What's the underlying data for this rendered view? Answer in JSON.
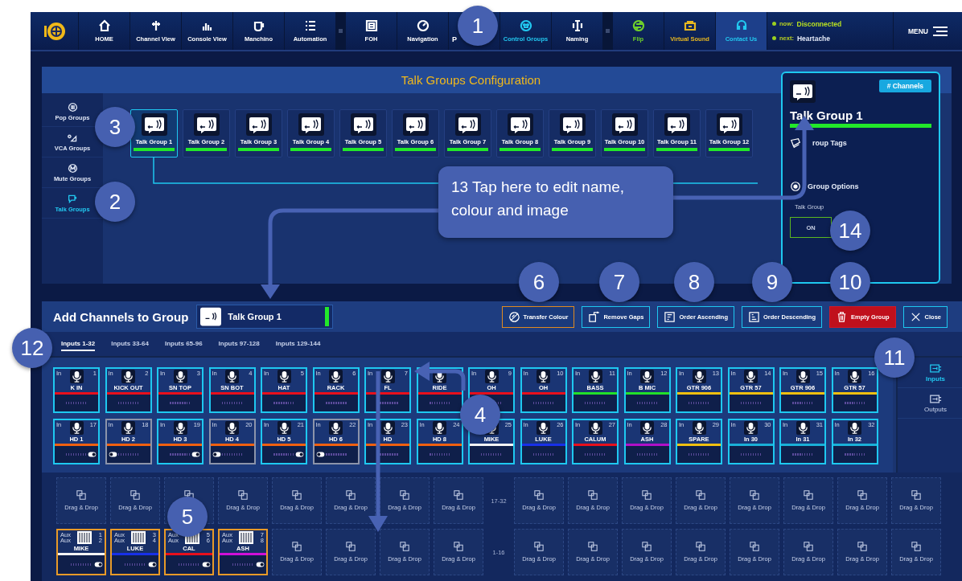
{
  "nav": {
    "items": [
      {
        "label": "HOME",
        "color": "#ffffff",
        "highlighted": false
      },
      {
        "label": "Channel View",
        "color": "#ffffff",
        "highlighted": false
      },
      {
        "label": "Console View",
        "color": "#ffffff",
        "highlighted": false
      },
      {
        "label": "Manchino",
        "color": "#ffffff",
        "highlighted": false
      },
      {
        "label": "Automation",
        "color": "#ffffff",
        "highlighted": false
      },
      {
        "label": "FOH",
        "color": "#ffffff",
        "highlighted": false
      },
      {
        "label": "Navigation",
        "color": "#ffffff",
        "highlighted": false
      },
      {
        "label": "P",
        "color": "#ffffff",
        "highlighted": false
      },
      {
        "label": "Control Groups",
        "color": "#22c8f0",
        "highlighted": false
      },
      {
        "label": "Naming",
        "color": "#ffffff",
        "highlighted": false
      },
      {
        "label": "Flip",
        "color": "#6fd12a",
        "highlighted": false
      },
      {
        "label": "Virtual Sound",
        "color": "#e8b820",
        "highlighted": false
      },
      {
        "label": "Contact Us",
        "color": "#22c8f0",
        "highlighted": true
      }
    ],
    "now_label": "now:",
    "now_value": "Disconnected",
    "next_label": "next:",
    "next_value": "Heartache",
    "menu": "MENU"
  },
  "config": {
    "title": "Talk Groups Configuration",
    "sidebar": [
      {
        "label": "Pop Groups",
        "selected": false
      },
      {
        "label": "VCA Groups",
        "selected": false
      },
      {
        "label": "Mute Groups",
        "selected": false
      },
      {
        "label": "Talk Groups",
        "selected": true
      }
    ],
    "groups": [
      {
        "label": "Talk Group 1",
        "selected": true
      },
      {
        "label": "Talk Group 2",
        "selected": false
      },
      {
        "label": "Talk Group 3",
        "selected": false
      },
      {
        "label": "Talk Group 4",
        "selected": false
      },
      {
        "label": "Talk Group 5",
        "selected": false
      },
      {
        "label": "Talk Group 6",
        "selected": false
      },
      {
        "label": "Talk Group 7",
        "selected": false
      },
      {
        "label": "Talk Group 8",
        "selected": false
      },
      {
        "label": "Talk Group 9",
        "selected": false
      },
      {
        "label": "Talk Group 10",
        "selected": false
      },
      {
        "label": "Talk Group 11",
        "selected": false
      },
      {
        "label": "Talk Group 12",
        "selected": false
      }
    ],
    "panel": {
      "channels_button": "# Channels",
      "name": "Talk Group 1",
      "tags": "roup Tags",
      "options": "Group Options",
      "option_label": "Talk Group",
      "option_button": "ON"
    }
  },
  "add": {
    "title": "Add Channels to Group",
    "group_name": "Talk Group 1",
    "buttons": [
      {
        "label": "Transfer Colour",
        "kind": "accent"
      },
      {
        "label": "Remove Gaps",
        "kind": "normal"
      },
      {
        "label": "Order Ascending",
        "kind": "normal"
      },
      {
        "label": "Order Descending",
        "kind": "normal"
      },
      {
        "label": "Empty Group",
        "kind": "danger"
      },
      {
        "label": "Close",
        "kind": "normal"
      }
    ],
    "tabs": [
      {
        "label": "Inputs 1-32",
        "selected": true
      },
      {
        "label": "Inputs 33-64",
        "selected": false
      },
      {
        "label": "Inputs 65-96",
        "selected": false
      },
      {
        "label": "Inputs 97-128",
        "selected": false
      },
      {
        "label": "Inputs 129-144",
        "selected": false
      }
    ],
    "side_tabs": [
      {
        "label": "Inputs",
        "selected": true
      },
      {
        "label": "Outputs",
        "selected": false
      }
    ],
    "channels": [
      {
        "kind": "plain",
        "type": "In",
        "number": "1",
        "name": "K IN",
        "color": "#e8101c",
        "selected": true
      },
      {
        "kind": "plain",
        "type": "In",
        "number": "2",
        "name": "KICK OUT",
        "color": "#e8101c",
        "selected": true
      },
      {
        "kind": "plain",
        "type": "In",
        "number": "3",
        "name": "SN TOP",
        "color": "#e8101c",
        "selected": true
      },
      {
        "kind": "plain",
        "type": "In",
        "number": "4",
        "name": "SN BOT",
        "color": "#e8101c",
        "selected": true
      },
      {
        "kind": "plain",
        "type": "In",
        "number": "5",
        "name": "HAT",
        "color": "#e8101c",
        "selected": true
      },
      {
        "kind": "plain",
        "type": "In",
        "number": "6",
        "name": "RACK",
        "color": "#e8101c",
        "selected": true
      },
      {
        "kind": "plain",
        "type": "In",
        "number": "7",
        "name": "FL",
        "color": "#e8101c",
        "selected": true
      },
      {
        "kind": "plain",
        "name": "RIDE",
        "color": "#e8101c",
        "selected": true
      },
      {
        "kind": "plain",
        "type": "In",
        "number": "9",
        "name": "OH",
        "color": "#e8101c",
        "selected": true
      },
      {
        "kind": "plain",
        "type": "In",
        "number": "10",
        "name": "OH",
        "color": "#e8101c",
        "selected": true
      },
      {
        "kind": "plain",
        "type": "In",
        "number": "11",
        "name": "BASS",
        "color": "#22e02a",
        "selected": true
      },
      {
        "kind": "plain",
        "type": "In",
        "number": "12",
        "name": "B MIC",
        "color": "#22e02a",
        "selected": true
      },
      {
        "kind": "plain",
        "type": "In",
        "number": "13",
        "name": "GTR 906",
        "color": "#f0c010",
        "selected": true
      },
      {
        "kind": "plain",
        "type": "In",
        "number": "14",
        "name": "GTR 57",
        "color": "#f0c010",
        "selected": true
      },
      {
        "kind": "plain",
        "type": "In",
        "number": "15",
        "name": "GTR 906",
        "color": "#f0c010",
        "selected": true
      },
      {
        "kind": "plain",
        "type": "In",
        "number": "16",
        "name": "GTR 57",
        "color": "#f0c010",
        "selected": true
      },
      {
        "kind": "right",
        "type": "In",
        "number": "17",
        "name": "HD 1",
        "color": "#f06010",
        "selected": true
      },
      {
        "kind": "left",
        "type": "In",
        "number": "18",
        "name": "HD 2",
        "color": "#f06010",
        "selected": false
      },
      {
        "kind": "right",
        "type": "In",
        "number": "19",
        "name": "HD 3",
        "color": "#f06010",
        "selected": true
      },
      {
        "kind": "left",
        "type": "In",
        "number": "20",
        "name": "HD 4",
        "color": "#f06010",
        "selected": false
      },
      {
        "kind": "right",
        "type": "In",
        "number": "21",
        "name": "HD 5",
        "color": "#f06010",
        "selected": true
      },
      {
        "kind": "left",
        "type": "In",
        "number": "22",
        "name": "HD 6",
        "color": "#f06010",
        "selected": false
      },
      {
        "kind": "plain",
        "type": "In",
        "number": "23",
        "name": "HD",
        "color": "#f06010",
        "selected": true
      },
      {
        "kind": "plain",
        "type": "In",
        "number": "24",
        "name": "HD 8",
        "color": "#f06010",
        "selected": true
      },
      {
        "kind": "plain",
        "number": "25",
        "name": "MIKE",
        "color": "#f4f4f4",
        "selected": true
      },
      {
        "kind": "plain",
        "type": "In",
        "number": "26",
        "name": "LUKE",
        "color": "#1830e8",
        "selected": true
      },
      {
        "kind": "plain",
        "type": "In",
        "number": "27",
        "name": "CALUM",
        "color": "#e8101c",
        "selected": true
      },
      {
        "kind": "plain",
        "type": "In",
        "number": "28",
        "name": "ASH",
        "color": "#b010c8",
        "selected": true
      },
      {
        "kind": "plain",
        "type": "In",
        "number": "29",
        "name": "SPARE",
        "color": "#f0c010",
        "selected": true
      },
      {
        "kind": "plain",
        "type": "In",
        "number": "30",
        "name": "In 30",
        "color": "#1ab0d8",
        "selected": true
      },
      {
        "kind": "plain",
        "type": "In",
        "number": "31",
        "name": "In 31",
        "color": "#1ab0d8",
        "selected": true
      },
      {
        "kind": "plain",
        "type": "In",
        "number": "32",
        "name": "In 32",
        "color": "#1ab0d8",
        "selected": true
      }
    ],
    "slot_rows": [
      {
        "label": "17-32",
        "slots": [
          {
            "kind": "empty",
            "label": "Drag & Drop"
          },
          {
            "kind": "empty",
            "label": "Drag & Drop"
          },
          {
            "kind": "empty"
          },
          {
            "kind": "empty",
            "label": "Drag & Drop"
          },
          {
            "kind": "empty",
            "label": "Drag & Drop"
          },
          {
            "kind": "empty",
            "label": "Drag & Drop"
          },
          {
            "kind": "empty",
            "label": "Drag & Drop"
          },
          {
            "kind": "empty",
            "label": "Drag & Drop"
          },
          {
            "kind": "empty",
            "label": "Drag & Drop"
          },
          {
            "kind": "empty",
            "label": "Drag & Drop"
          },
          {
            "kind": "empty",
            "label": "Drag & Drop"
          },
          {
            "kind": "empty",
            "label": "Drag & Drop"
          },
          {
            "kind": "empty",
            "label": "Drag & Drop"
          },
          {
            "kind": "empty",
            "label": "Drag & Drop"
          },
          {
            "kind": "empty",
            "label": "Drag & Drop"
          },
          {
            "kind": "empty",
            "label": "Drag & Drop"
          }
        ]
      },
      {
        "label": "1-16",
        "slots": [
          {
            "kind": "aux",
            "name": "MIKE",
            "type_a": "Aux",
            "num_a": "1",
            "type_b": "Aux",
            "num_b": "2",
            "color": "#f4f4f4"
          },
          {
            "kind": "aux",
            "name": "LUKE",
            "type_a": "Aux",
            "num_a": "3",
            "type_b": "Aux",
            "num_b": "4",
            "color": "#1830e8"
          },
          {
            "kind": "aux",
            "name": "CAL",
            "type_a": "Aux",
            "num_a": "5",
            "type_b": "Aux",
            "num_b": "6",
            "color": "#e8101c"
          },
          {
            "kind": "aux",
            "name": "ASH",
            "type_a": "Aux",
            "num_a": "7",
            "type_b": "Aux",
            "num_b": "8",
            "color": "#d010d8"
          },
          {
            "kind": "empty",
            "label": "Drag & Drop"
          },
          {
            "kind": "empty",
            "label": "Drag & Drop"
          },
          {
            "kind": "empty",
            "label": "Drag & Drop"
          },
          {
            "kind": "empty",
            "label": "Drag & Drop"
          },
          {
            "kind": "empty",
            "label": "Drag & Drop"
          },
          {
            "kind": "empty",
            "label": "Drag & Drop"
          },
          {
            "kind": "empty",
            "label": "Drag & Drop"
          },
          {
            "kind": "empty",
            "label": "Drag & Drop"
          },
          {
            "kind": "empty",
            "label": "Drag & Drop"
          },
          {
            "kind": "empty",
            "label": "Drag & Drop"
          },
          {
            "kind": "empty",
            "label": "Drag & Drop"
          },
          {
            "kind": "empty",
            "label": "Drag & Drop"
          }
        ]
      }
    ]
  },
  "callouts": [
    {
      "label": "1"
    },
    {
      "label": "2"
    },
    {
      "label": "3"
    },
    {
      "label": "4"
    },
    {
      "label": "5"
    },
    {
      "label": "6"
    },
    {
      "label": "7"
    },
    {
      "label": "8"
    },
    {
      "label": "9"
    },
    {
      "label": "10"
    },
    {
      "label": "11"
    },
    {
      "label": "12"
    },
    {
      "label": "14"
    }
  ],
  "note": {
    "text": "13 Tap here to edit name, colour and image"
  }
}
